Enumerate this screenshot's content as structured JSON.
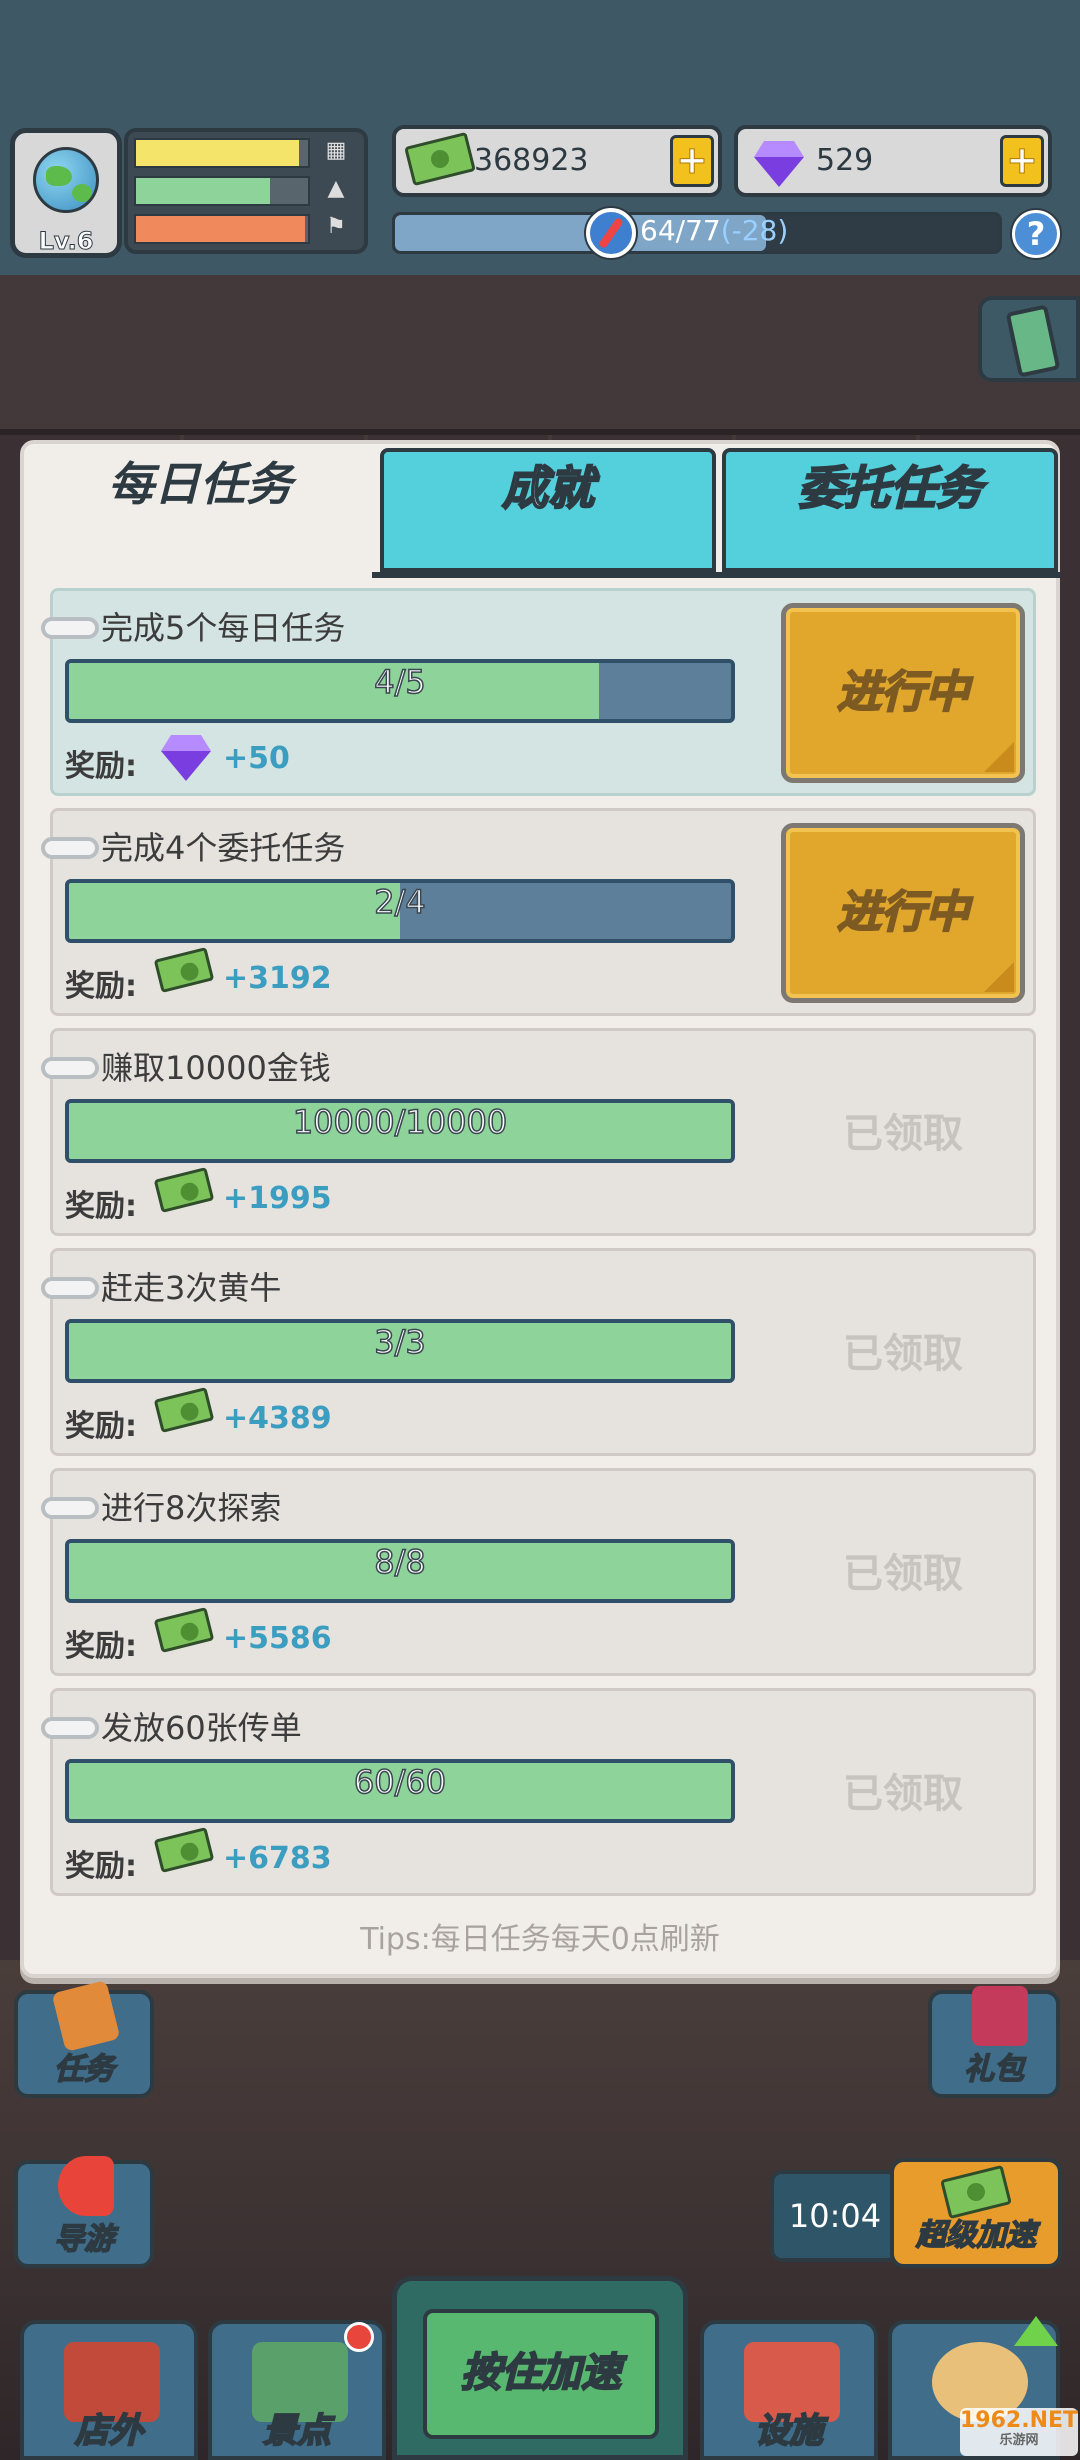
{
  "hud": {
    "level": "Lv.6",
    "money": "368923",
    "gems": "529",
    "plus_label": "+",
    "exp_current": "64",
    "exp_separator": "/",
    "exp_max": "77",
    "exp_delta": "(-28)",
    "help_label": "?",
    "stat_bars": [
      {
        "icon": "building-icon",
        "fill": 0.95,
        "color": "#f4e46a"
      },
      {
        "icon": "landscape-icon",
        "fill": 0.78,
        "color": "#8dd39a"
      },
      {
        "icon": "flag-icon",
        "fill": 0.98,
        "color": "#f08a5d"
      }
    ],
    "colors": {
      "panel": "#f1eeea",
      "tab_active": "#53d0dc",
      "progress": "#8dd39a",
      "button": "#e1a72c"
    }
  },
  "tabs": [
    {
      "label": "每日任务",
      "active": true
    },
    {
      "label": "成就",
      "active": false
    },
    {
      "label": "委托任务",
      "active": false
    }
  ],
  "reward_label": "奖励:",
  "quests": [
    {
      "title": "完成5个每日任务",
      "progress_text": "4/5",
      "fill": 0.8,
      "reward_icon": "gem-icon",
      "reward": "+50",
      "status": "in_progress",
      "button": "进行中"
    },
    {
      "title": "完成4个委托任务",
      "progress_text": "2/4",
      "fill": 0.5,
      "reward_icon": "cash-icon",
      "reward": "+3192",
      "status": "in_progress",
      "button": "进行中"
    },
    {
      "title": "赚取10000金钱",
      "progress_text": "10000/10000",
      "fill": 1.0,
      "reward_icon": "cash-icon",
      "reward": "+1995",
      "status": "claimed",
      "button": "已领取"
    },
    {
      "title": "赶走3次黄牛",
      "progress_text": "3/3",
      "fill": 1.0,
      "reward_icon": "cash-icon",
      "reward": "+4389",
      "status": "claimed",
      "button": "已领取"
    },
    {
      "title": "进行8次探索",
      "progress_text": "8/8",
      "fill": 1.0,
      "reward_icon": "cash-icon",
      "reward": "+5586",
      "status": "claimed",
      "button": "已领取"
    },
    {
      "title": "发放60张传单",
      "progress_text": "60/60",
      "fill": 1.0,
      "reward_icon": "cash-icon",
      "reward": "+6783",
      "status": "claimed",
      "button": "已领取"
    }
  ],
  "tips": "Tips:每日任务每天0点刷新",
  "scene": {
    "tasks_button": "任务",
    "guide_button": "导游",
    "gift_button": "礼包",
    "timer": "10:04",
    "super_boost_button": "超级加速"
  },
  "bottom_nav": {
    "outside": "店外",
    "sights": "景点",
    "hold_boost": "按住加速",
    "facilities": "设施"
  },
  "watermark": {
    "brand": "1962",
    "tld": ".NET",
    "sub": "乐游网"
  }
}
